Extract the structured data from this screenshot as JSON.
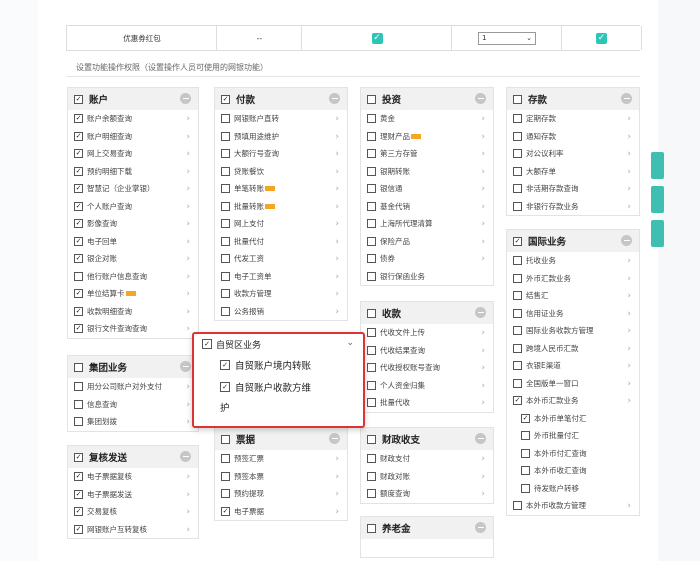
{
  "coupon_row": {
    "label": "优惠券红包",
    "dash": "--",
    "select_value": "1"
  },
  "section_title": "设置功能操作权限（设置操作人员可使用的网银功能）",
  "panels": {
    "account": {
      "title": "账户",
      "items": [
        {
          "label": "账户余额查询",
          "checked": true,
          "arrow": true
        },
        {
          "label": "账户明细查询",
          "checked": true,
          "arrow": true
        },
        {
          "label": "网上交易查询",
          "checked": true,
          "arrow": true
        },
        {
          "label": "预约明细下载",
          "checked": true,
          "arrow": true
        },
        {
          "label": "智慧记（企业掌银）",
          "checked": true,
          "arrow": true
        },
        {
          "label": "个人账户查询",
          "checked": true,
          "arrow": true
        },
        {
          "label": "影像查询",
          "checked": true,
          "arrow": true
        },
        {
          "label": "电子回单",
          "checked": true,
          "arrow": true
        },
        {
          "label": "银企对账",
          "checked": true,
          "arrow": true
        },
        {
          "label": "他行账户信息查询",
          "checked": false,
          "arrow": true
        },
        {
          "label": "单位结算卡",
          "checked": true,
          "arrow": true,
          "tag": true
        },
        {
          "label": "收款明细查询",
          "checked": true,
          "arrow": true
        },
        {
          "label": "银行文件查询查询",
          "checked": true,
          "arrow": true
        }
      ]
    },
    "payment": {
      "title": "付款",
      "items": [
        {
          "label": "网银账户直转",
          "checked": false,
          "arrow": true
        },
        {
          "label": "预填用途维护",
          "checked": false,
          "arrow": true
        },
        {
          "label": "大额行号查询",
          "checked": false,
          "arrow": true
        },
        {
          "label": "贷账餐饮",
          "checked": false,
          "arrow": true
        },
        {
          "label": "单笔转账",
          "checked": false,
          "arrow": true,
          "tag": true
        },
        {
          "label": "批量转账",
          "checked": false,
          "arrow": true,
          "tag": true
        },
        {
          "label": "网上支付",
          "checked": false,
          "arrow": true
        },
        {
          "label": "批量代付",
          "checked": false,
          "arrow": true
        },
        {
          "label": "代发工资",
          "checked": false,
          "arrow": true
        },
        {
          "label": "电子工资单",
          "checked": false,
          "arrow": true
        },
        {
          "label": "收款方管理",
          "checked": false,
          "arrow": true
        },
        {
          "label": "公务报销",
          "checked": false,
          "arrow": true
        }
      ]
    },
    "invest": {
      "title": "投资",
      "items": [
        {
          "label": "黄金",
          "checked": false,
          "arrow": true
        },
        {
          "label": "理财产品",
          "checked": false,
          "arrow": true,
          "tag": true
        },
        {
          "label": "第三方存管",
          "checked": false,
          "arrow": true
        },
        {
          "label": "银期转账",
          "checked": false,
          "arrow": true
        },
        {
          "label": "银信通",
          "checked": false,
          "arrow": true
        },
        {
          "label": "基金代销",
          "checked": false,
          "arrow": true
        },
        {
          "label": "上海所代理清算",
          "checked": false,
          "arrow": true
        },
        {
          "label": "保险产品",
          "checked": false,
          "arrow": true
        },
        {
          "label": "债券",
          "checked": false,
          "arrow": true
        },
        {
          "label": "银行保函业务",
          "checked": false,
          "arrow": false
        }
      ]
    },
    "deposit": {
      "title": "存款",
      "items": [
        {
          "label": "定期存款",
          "checked": false,
          "arrow": true
        },
        {
          "label": "通知存款",
          "checked": false,
          "arrow": true
        },
        {
          "label": "对公议利率",
          "checked": false,
          "arrow": true
        },
        {
          "label": "大额存单",
          "checked": false,
          "arrow": true
        },
        {
          "label": "非活期存款查询",
          "checked": false,
          "arrow": true
        },
        {
          "label": "非银行存款业务",
          "checked": false,
          "arrow": true
        }
      ]
    },
    "collect": {
      "title": "收款",
      "items": [
        {
          "label": "代收文件上传",
          "checked": false,
          "arrow": true
        },
        {
          "label": "代收结果查询",
          "checked": false,
          "arrow": true
        },
        {
          "label": "代收授权账号查询",
          "checked": false,
          "arrow": true
        },
        {
          "label": "个人资金归集",
          "checked": false,
          "arrow": true
        },
        {
          "label": "批量代收",
          "checked": false,
          "arrow": true
        }
      ]
    },
    "intl": {
      "title": "国际业务",
      "items": [
        {
          "label": "托收业务",
          "checked": false,
          "arrow": true
        },
        {
          "label": "外币汇款业务",
          "checked": false,
          "arrow": true
        },
        {
          "label": "结售汇",
          "checked": false,
          "arrow": true
        },
        {
          "label": "信用证业务",
          "checked": false,
          "arrow": true
        },
        {
          "label": "国际业务收款方管理",
          "checked": false,
          "arrow": true
        },
        {
          "label": "跨境人民币汇款",
          "checked": false,
          "arrow": true
        },
        {
          "label": "衣银E渠道",
          "checked": false,
          "arrow": true
        },
        {
          "label": "全国版单一窗口",
          "checked": false,
          "arrow": true
        },
        {
          "label": "本外币汇款业务",
          "checked": true,
          "arrow": true
        },
        {
          "label": "本外币单笔付汇",
          "checked": true,
          "arrow": false,
          "sub": true
        },
        {
          "label": "外币批量付汇",
          "checked": false,
          "arrow": false,
          "sub": true
        },
        {
          "label": "本外币付汇查询",
          "checked": false,
          "arrow": false,
          "sub": true
        },
        {
          "label": "本外币收汇查询",
          "checked": false,
          "arrow": false,
          "sub": true
        },
        {
          "label": "待发账户转移",
          "checked": false,
          "arrow": false,
          "sub": true
        },
        {
          "label": "本外币收款方管理",
          "checked": false,
          "arrow": true
        }
      ]
    },
    "group": {
      "title": "集团业务",
      "items": [
        {
          "label": "用分公司账户对外支付",
          "checked": false,
          "arrow": true
        },
        {
          "label": "信息查询",
          "checked": false,
          "arrow": true
        },
        {
          "label": "集团划拨",
          "checked": false,
          "arrow": true
        }
      ]
    },
    "review": {
      "title": "复核发送",
      "items": [
        {
          "label": "电子票据复核",
          "checked": true,
          "arrow": true
        },
        {
          "label": "电子票据发送",
          "checked": true,
          "arrow": true
        },
        {
          "label": "交易复核",
          "checked": true,
          "arrow": true
        },
        {
          "label": "网银账户互转复核",
          "checked": true,
          "arrow": true
        }
      ]
    },
    "bill": {
      "title": "票据",
      "items": [
        {
          "label": "预签汇票",
          "checked": false,
          "arrow": true
        },
        {
          "label": "预签本票",
          "checked": false,
          "arrow": true
        },
        {
          "label": "预约提现",
          "checked": false,
          "arrow": true
        },
        {
          "label": "电子票据",
          "checked": true,
          "arrow": true
        }
      ]
    },
    "fiscal": {
      "title": "财政收支",
      "items": [
        {
          "label": "财政支付",
          "checked": false,
          "arrow": true
        },
        {
          "label": "财政对账",
          "checked": false,
          "arrow": true
        },
        {
          "label": "额度查询",
          "checked": false,
          "arrow": true
        }
      ]
    },
    "pension": {
      "title": "养老金",
      "items": []
    }
  },
  "popup": {
    "title": "自贸区业务",
    "opt1": "自贸账户境内转账",
    "opt2_line1": "自贸账户收款方维",
    "opt2_line2": "护"
  }
}
